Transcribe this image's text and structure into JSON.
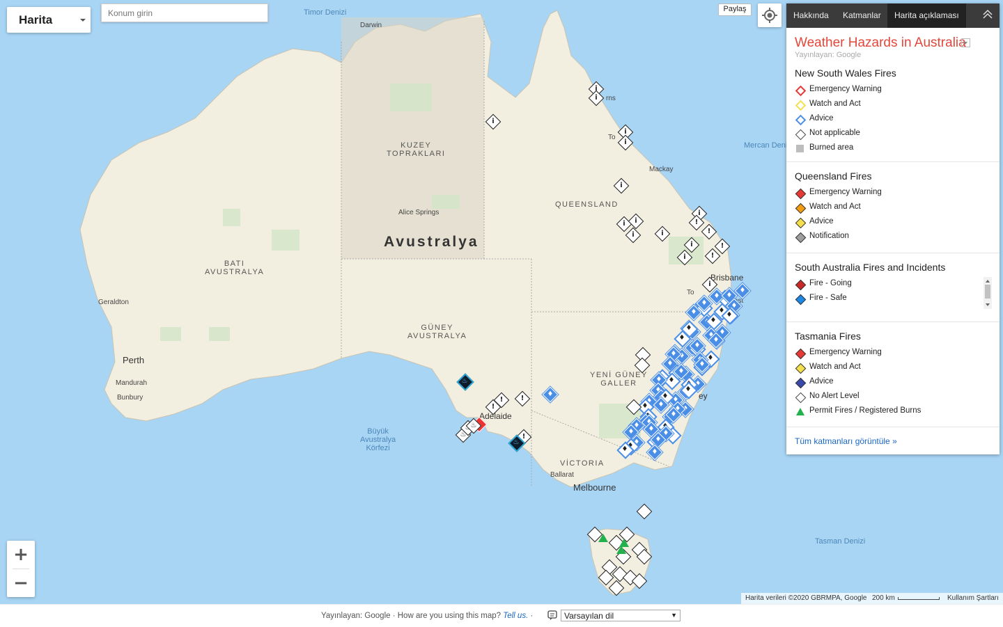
{
  "maptype": {
    "label": "Harita"
  },
  "search": {
    "placeholder": "Konum girin"
  },
  "share": {
    "label": "Paylaş"
  },
  "zoom": {
    "in": "+",
    "out": "−"
  },
  "map_labels": {
    "timor_sea": "Timor Denizi",
    "coral_sea": "Mercan Deni",
    "tasman_sea": "Tasman Denizi",
    "great_bight": "Büyük\nAvustralya\nKörfezi",
    "darwin": "Darwin",
    "nt": "KUZEY\nTOPRAKLARI",
    "alice": "Alice Springs",
    "country": "Avustralya",
    "qld": "QUEENSLAND",
    "wa": "BATI\nAVUSTRALYA",
    "sa": "GÜNEY\nAVUSTRALYA",
    "nsw": "YENİ GÜNEY\nGALLER",
    "vic": "VİCTORIA",
    "geraldton": "Geraldton",
    "perth": "Perth",
    "mandurah": "Mandurah",
    "bunbury": "Bunbury",
    "mackay": "Mackay",
    "brisbane": "Brisbane",
    "adelaide": "Adelaide",
    "ballarat": "Ballarat",
    "melbourne": "Melbourne",
    "cairns_frag": "rns",
    "townsville_frag": "To",
    "gold_coast_frag": "ast",
    "sydney_frag": "ey",
    "toowoomba_frag": "To"
  },
  "attribution": {
    "data": "Harita verileri ©2020 GBRMPA, Google",
    "scale": "200 km",
    "terms": "Kullanım Şartları"
  },
  "panel": {
    "tabs": [
      "Hakkında",
      "Katmanlar",
      "Harita açıklaması"
    ],
    "active_tab": "Harita açıklaması",
    "title": "Weather Hazards in Australia",
    "publisher": "Yayınlayan: Google",
    "sections": [
      {
        "title": "New South Wales Fires",
        "items": [
          {
            "label": "Emergency Warning",
            "color": "#e53935"
          },
          {
            "label": "Watch and Act",
            "color": "#f4e04d"
          },
          {
            "label": "Advice",
            "color": "#4b8ee6"
          },
          {
            "label": "Not applicable",
            "color": "#ffffff"
          },
          {
            "label": "Burned area",
            "color": "#bdbdbd"
          }
        ]
      },
      {
        "title": "Queensland Fires",
        "items": [
          {
            "label": "Emergency Warning",
            "color": "#e53935"
          },
          {
            "label": "Watch and Act",
            "color": "#f39c12"
          },
          {
            "label": "Advice",
            "color": "#f4e04d"
          },
          {
            "label": "Notification",
            "color": "#9e9e9e"
          }
        ]
      },
      {
        "title": "South Australia Fires and Incidents",
        "items": [
          {
            "label": "Fire - Going",
            "color": "#c62828"
          },
          {
            "label": "Fire - Safe",
            "color": "#1e88e5"
          }
        ]
      },
      {
        "title": "Tasmania Fires",
        "items": [
          {
            "label": "Emergency Warning",
            "color": "#e53935"
          },
          {
            "label": "Watch and Act",
            "color": "#f4e04d"
          },
          {
            "label": "Advice",
            "color": "#3949ab"
          },
          {
            "label": "No Alert Level",
            "color": "#ffffff"
          },
          {
            "label": "Permit Fires / Registered Burns",
            "color": "#22b14c"
          }
        ]
      }
    ],
    "view_all": "Tüm katmanları görüntüle »"
  },
  "footer": {
    "publisher": "Yayınlayan: Google · How are you using this map?",
    "tell_us": "Tell us.",
    "sep": " · ",
    "language": "Varsayılan dil"
  }
}
